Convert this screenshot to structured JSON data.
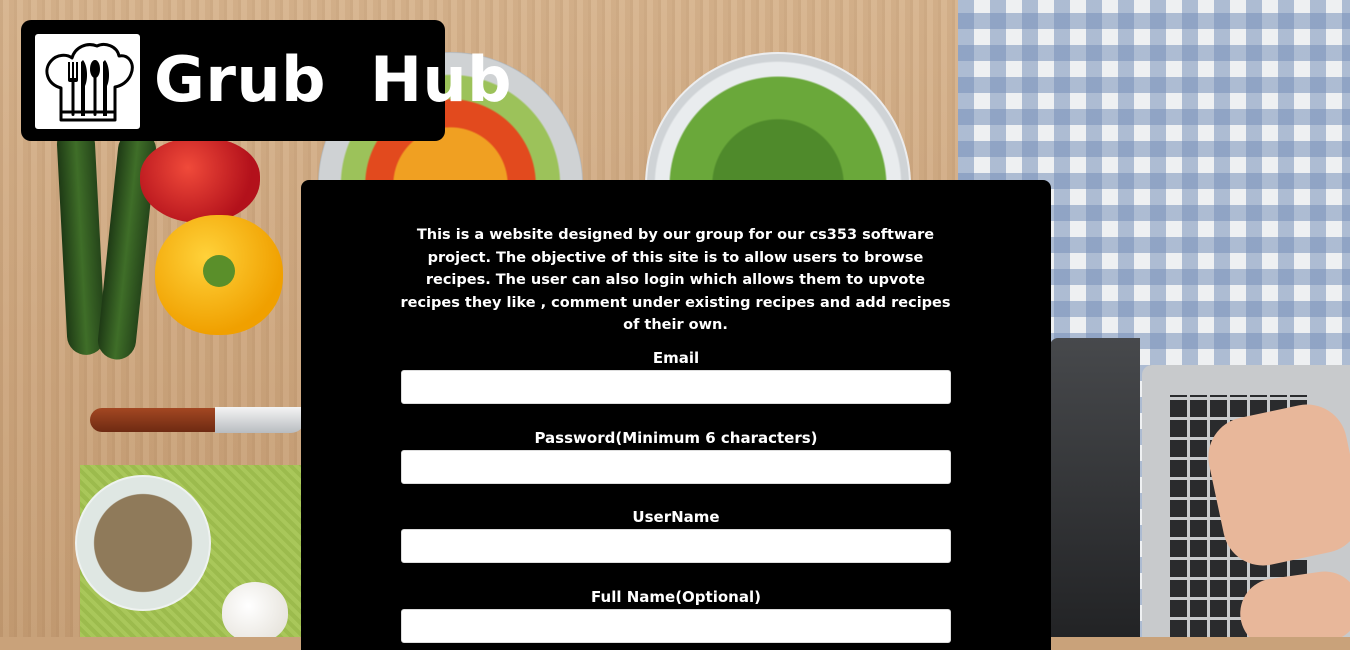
{
  "logo": {
    "text": "Grub  Hub",
    "icon": "chef-hat-cutlery-icon"
  },
  "intro": {
    "text": "This is a website designed by our group for our cs353 software project. The objective of this site is to allow users to browse recipes. The user can also login which allows them to upvote recipes they like , comment under existing recipes and add recipes of their own."
  },
  "form": {
    "fields": [
      {
        "label": "Email",
        "value": "",
        "placeholder": ""
      },
      {
        "label": "Password(Minimum 6 characters)",
        "value": "",
        "placeholder": ""
      },
      {
        "label": "UserName",
        "value": "",
        "placeholder": ""
      },
      {
        "label": "Full Name(Optional)",
        "value": "",
        "placeholder": ""
      }
    ]
  },
  "colors": {
    "panel": "#000000",
    "text": "#ffffff",
    "input": "#ffffff"
  }
}
